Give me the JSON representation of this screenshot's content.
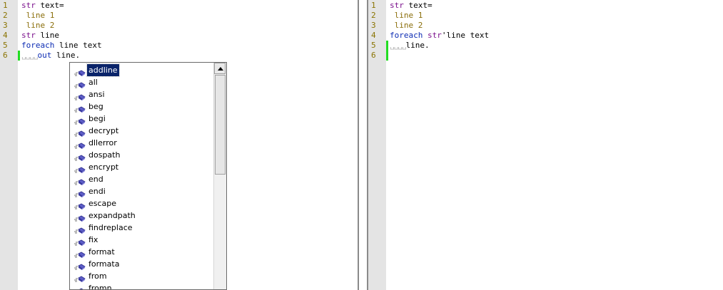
{
  "left_editor": {
    "line_numbers": [
      "1",
      "2",
      "3",
      "4",
      "5",
      "6"
    ],
    "lines": [
      {
        "kw": "str",
        "rest": " text="
      },
      {
        "str": " line 1"
      },
      {
        "str": " line 2"
      },
      {
        "kw": "str",
        "rest": " line"
      },
      {
        "kwblue": "foreach",
        "rest": " line text"
      },
      {
        "tab": "␣␣␣␣",
        "kwblue": "out",
        "rest": " line."
      }
    ]
  },
  "right_editor": {
    "line_numbers": [
      "1",
      "2",
      "3",
      "4",
      "5",
      "6"
    ],
    "lines": [
      {
        "kw": "str",
        "rest": " text="
      },
      {
        "str": " line 1"
      },
      {
        "str": " line 2"
      },
      {
        "kwblue": "foreach",
        "kw2": " str",
        "rest": "'line text"
      },
      {
        "tab": "␣␣␣␣",
        "rest": "line."
      },
      {}
    ]
  },
  "autocomplete": {
    "selected_index": 0,
    "items": [
      "addline",
      "all",
      "ansi",
      "beg",
      "begi",
      "decrypt",
      "dllerror",
      "dospath",
      "encrypt",
      "end",
      "endi",
      "escape",
      "expandpath",
      "findreplace",
      "fix",
      "format",
      "formata",
      "from",
      "fromn"
    ]
  },
  "colors": {
    "keyword": "#7b108c",
    "keyword_blue": "#0b2bb3",
    "string": "#8a6e0a",
    "selection": "#0a246a",
    "change_bar": "#22dd22"
  }
}
